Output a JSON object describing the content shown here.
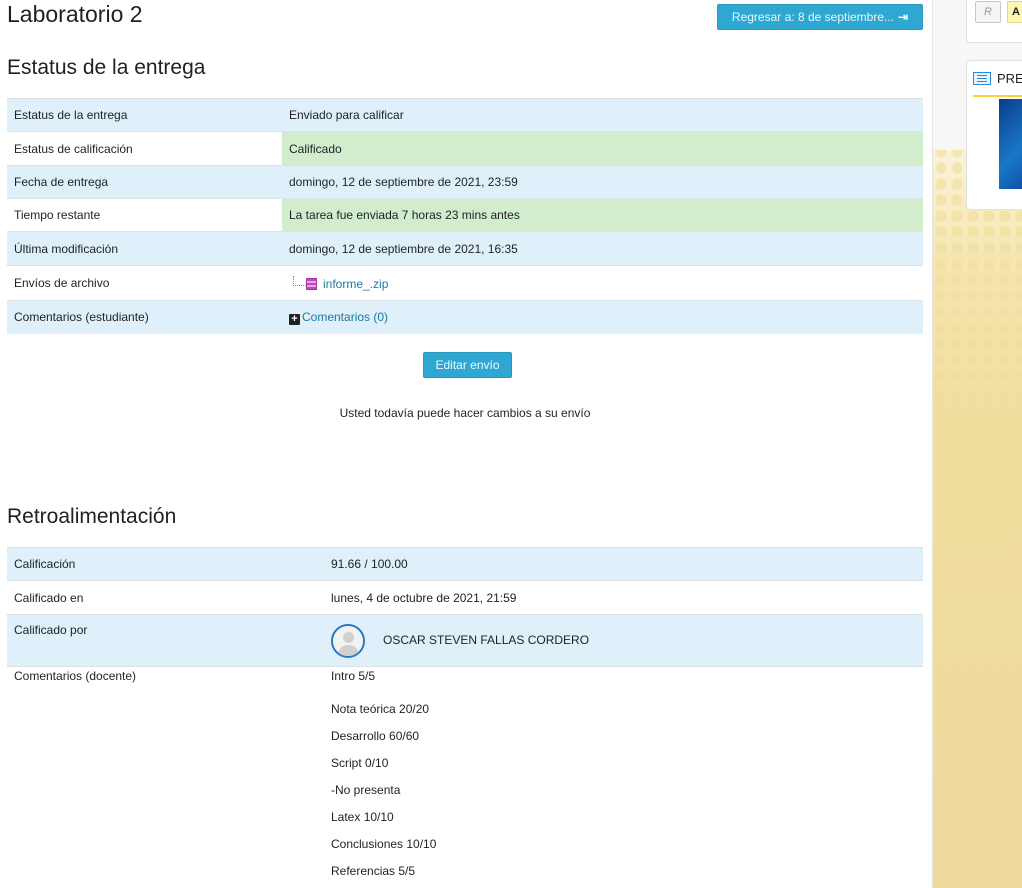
{
  "page": {
    "title": "Laboratorio 2",
    "back_button": "Regresar a: 8 de septiembre..."
  },
  "submission": {
    "heading": "Estatus de la entrega",
    "rows": [
      {
        "label": "Estatus de la entrega",
        "value": "Enviado para calificar"
      },
      {
        "label": "Estatus de calificación",
        "value": "Calificado"
      },
      {
        "label": "Fecha de entrega",
        "value": "domingo, 12 de septiembre de 2021, 23:59"
      },
      {
        "label": "Tiempo restante",
        "value": "La tarea fue enviada 7 horas 23 mins antes"
      },
      {
        "label": "Última modificación",
        "value": "domingo, 12 de septiembre de 2021, 16:35"
      },
      {
        "label": "Envíos de archivo",
        "value": "informe_.zip"
      },
      {
        "label": "Comentarios (estudiante)",
        "value": "Comentarios (0)"
      }
    ],
    "edit_button": "Editar envío",
    "note": "Usted todavía puede hacer cambios a su envío"
  },
  "feedback": {
    "heading": "Retroalimentación",
    "grade_label": "Calificación",
    "grade_value": "91.66 / 100.00",
    "graded_on_label": "Calificado en",
    "graded_on_value": "lunes, 4 de octubre de 2021, 21:59",
    "graded_by_label": "Calificado por",
    "graded_by_value": "OSCAR STEVEN FALLAS CORDERO",
    "comments_label": "Comentarios (docente)",
    "comments": [
      "Intro 5/5",
      "Nota teórica 20/20",
      "Desarrollo 60/60",
      "Script 0/10",
      "-No presenta",
      "Latex 10/10",
      "Conclusiones 10/10",
      "Referencias 5/5"
    ]
  },
  "sidebar": {
    "tag_r": "R",
    "tag_a": "A",
    "block_title": "PRE"
  },
  "colors": {
    "button": "#2ea8d3",
    "row_blue": "#dff0fb",
    "row_green": "#d2ecce",
    "link": "#1b7a9e"
  }
}
